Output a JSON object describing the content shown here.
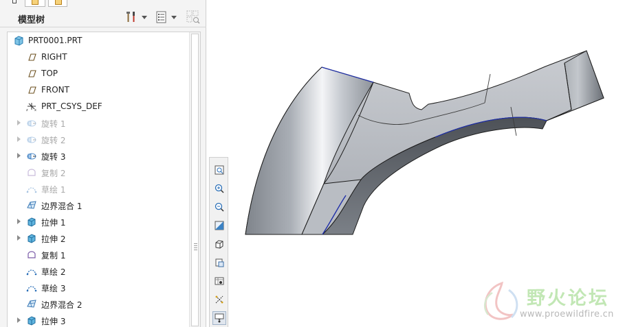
{
  "panel": {
    "title": "模型树",
    "settings_icon": "tools-icon",
    "show_icon": "tree-columns-icon",
    "filter_icon": "filter-grid-icon"
  },
  "tree": {
    "root": {
      "label": "PRT0001.PRT",
      "icon": "part-icon"
    },
    "items": [
      {
        "label": "RIGHT",
        "icon": "datum-plane-icon",
        "expandable": false,
        "dimmed": false
      },
      {
        "label": "TOP",
        "icon": "datum-plane-icon",
        "expandable": false,
        "dimmed": false
      },
      {
        "label": "FRONT",
        "icon": "datum-plane-icon",
        "expandable": false,
        "dimmed": false
      },
      {
        "label": "PRT_CSYS_DEF",
        "icon": "coordinate-system-icon",
        "expandable": false,
        "dimmed": false
      },
      {
        "label": "旋转 1",
        "icon": "revolve-icon",
        "expandable": true,
        "dimmed": true
      },
      {
        "label": "旋转 2",
        "icon": "revolve-icon",
        "expandable": true,
        "dimmed": true
      },
      {
        "label": "旋转 3",
        "icon": "revolve-icon",
        "expandable": true,
        "dimmed": false
      },
      {
        "label": "复制 2",
        "icon": "copy-surface-icon",
        "expandable": false,
        "dimmed": true
      },
      {
        "label": "草绘 1",
        "icon": "sketch-icon",
        "expandable": false,
        "dimmed": true
      },
      {
        "label": "边界混合 1",
        "icon": "boundary-blend-icon",
        "expandable": false,
        "dimmed": false
      },
      {
        "label": "拉伸 1",
        "icon": "extrude-icon",
        "expandable": true,
        "dimmed": false
      },
      {
        "label": "拉伸 2",
        "icon": "extrude-icon",
        "expandable": true,
        "dimmed": false
      },
      {
        "label": "复制 1",
        "icon": "copy-surface-icon",
        "expandable": false,
        "dimmed": false
      },
      {
        "label": "草绘 2",
        "icon": "sketch-icon",
        "expandable": false,
        "dimmed": false
      },
      {
        "label": "草绘 3",
        "icon": "sketch-icon",
        "expandable": false,
        "dimmed": false
      },
      {
        "label": "边界混合 2",
        "icon": "boundary-blend-icon",
        "expandable": false,
        "dimmed": false
      },
      {
        "label": "拉伸 3",
        "icon": "extrude-icon",
        "expandable": true,
        "dimmed": false
      }
    ]
  },
  "view_toolbar": [
    "refit-icon",
    "zoom-in-icon",
    "zoom-out-icon",
    "repaint-icon",
    "display-style-icon",
    "saved-orientations-icon",
    "named-views-icon",
    "datum-display-icon",
    "annotation-display-icon"
  ],
  "watermark": {
    "title": "野火论坛",
    "url": "www.proewildfire.cn"
  },
  "colors": {
    "panel_bg": "#f4f4f4",
    "model_edge": "#1c1c1c",
    "highlight_edge": "#1f2fa8",
    "watermark_green": "#c2e7b5"
  }
}
